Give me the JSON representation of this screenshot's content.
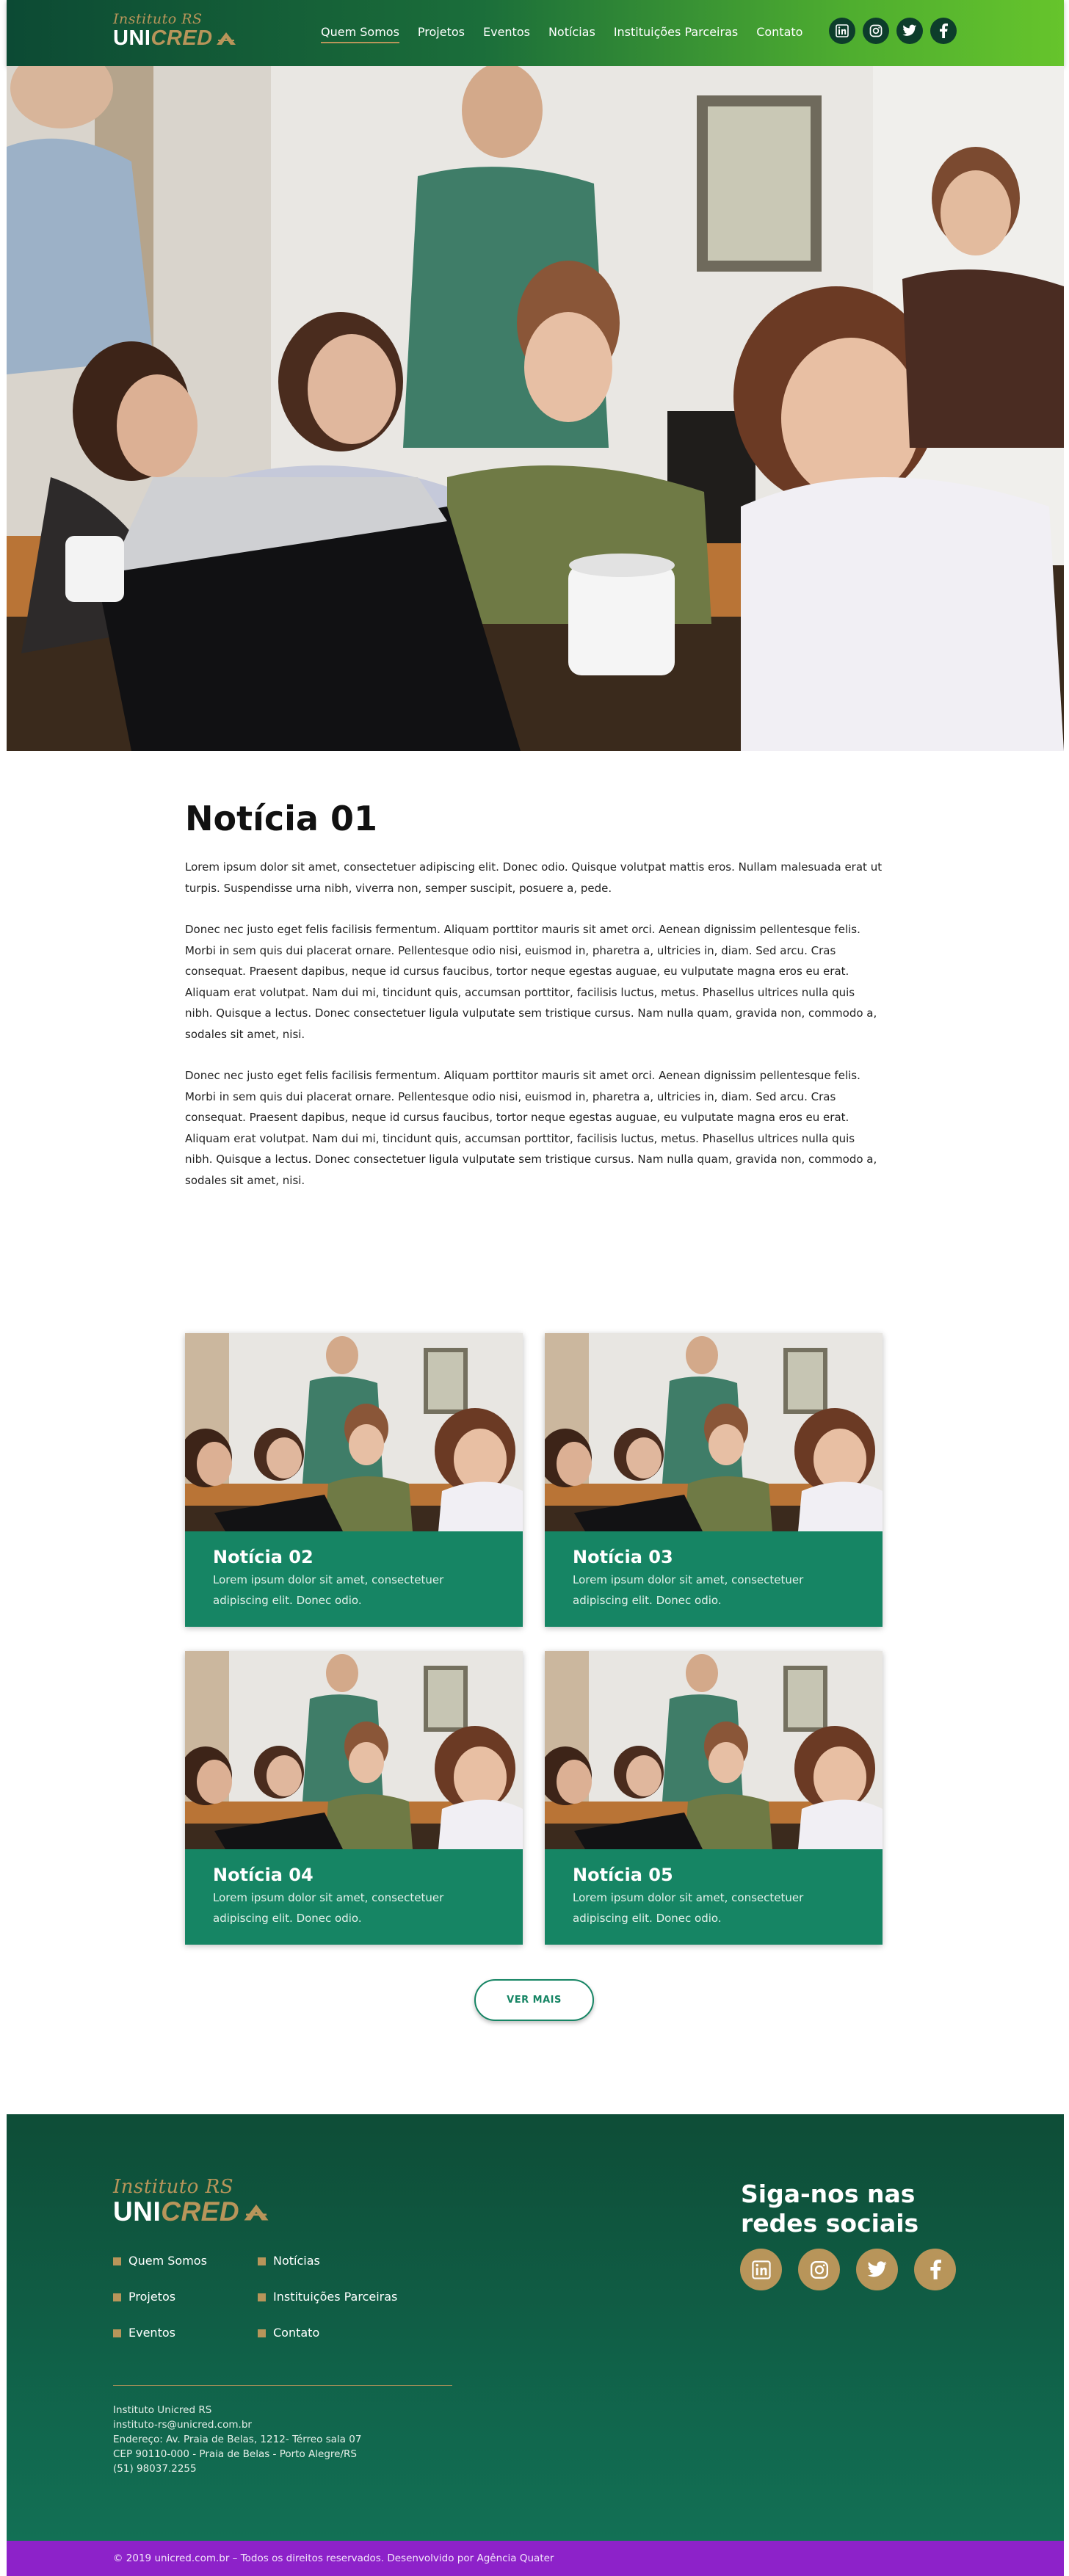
{
  "header": {
    "logo_script": "Instituto RS",
    "logo_uni": "UNI",
    "logo_cred": "CRED",
    "nav": [
      {
        "label": "Quem Somos",
        "active": true
      },
      {
        "label": "Projetos"
      },
      {
        "label": "Eventos"
      },
      {
        "label": "Notícias"
      },
      {
        "label": "Instituições Parceiras"
      },
      {
        "label": "Contato"
      }
    ],
    "social_icons": [
      "linkedin-icon",
      "instagram-icon",
      "twitter-icon",
      "facebook-icon"
    ]
  },
  "article": {
    "title": "Notícia 01",
    "paragraphs": [
      "Lorem ipsum dolor sit amet, consectetuer adipiscing elit. Donec odio. Quisque volutpat mattis eros. Nullam malesuada erat ut turpis. Suspendisse urna nibh, viverra non, semper suscipit, posuere a, pede.",
      "Donec nec justo eget felis facilisis fermentum. Aliquam porttitor mauris sit amet orci. Aenean dignissim pellentesque felis. Morbi in sem quis dui placerat ornare. Pellentesque odio nisi, euismod in, pharetra a, ultricies in, diam. Sed arcu. Cras consequat. Praesent dapibus, neque id cursus faucibus, tortor neque egestas auguae, eu vulputate magna eros eu erat. Aliquam erat volutpat. Nam dui mi, tincidunt quis, accumsan porttitor, facilisis luctus, metus.  Phasellus ultrices nulla quis nibh. Quisque a lectus. Donec consectetuer ligula vulputate sem tristique cursus. Nam nulla quam, gravida non, commodo a, sodales sit amet, nisi.",
      "Donec nec justo eget felis facilisis fermentum. Aliquam porttitor mauris sit amet orci. Aenean dignissim pellentesque felis. Morbi in sem quis dui placerat ornare. Pellentesque odio nisi, euismod in, pharetra a, ultricies in, diam. Sed arcu. Cras consequat. Praesent dapibus, neque id cursus faucibus, tortor neque egestas auguae, eu vulputate magna eros eu erat. Aliquam erat volutpat. Nam dui mi, tincidunt quis, accumsan porttitor, facilisis luctus, metus.  Phasellus ultrices nulla quis nibh. Quisque a lectus. Donec consectetuer ligula vulputate sem tristique cursus. Nam nulla quam, gravida non, commodo a, sodales sit amet, nisi."
    ]
  },
  "news_cards": [
    {
      "title": "Notícia 02",
      "text": "Lorem ipsum dolor sit amet, consectetuer adipiscing elit. Donec odio."
    },
    {
      "title": "Notícia 03",
      "text": "Lorem ipsum dolor sit amet, consectetuer adipiscing elit. Donec odio."
    },
    {
      "title": "Notícia 04",
      "text": "Lorem ipsum dolor sit amet, consectetuer adipiscing elit. Donec odio."
    },
    {
      "title": "Notícia 05",
      "text": "Lorem ipsum dolor sit amet, consectetuer adipiscing elit. Donec odio."
    }
  ],
  "more_button": "VER MAIS",
  "footer": {
    "logo_script": "Instituto RS",
    "logo_uni": "UNI",
    "logo_cred": "CRED",
    "nav": [
      "Quem Somos",
      "Notícias",
      "Projetos",
      "Instituições Parceiras",
      "Eventos",
      "Contato"
    ],
    "contact": [
      "Instituto Unicred RS",
      "instituto-rs@unicred.com.br",
      "Endereço: Av. Praia de Belas, 1212- Térreo sala 07",
      "CEP 90110-000 - Praia de Belas - Porto Alegre/RS",
      "(51) 98037.2255"
    ],
    "social_title": "Siga-nos nas redes sociais",
    "social_icons": [
      "linkedin-icon",
      "instagram-icon",
      "twitter-icon",
      "facebook-icon"
    ]
  },
  "copyright": "© 2019 unicred.com.br – Todos os direitos reservados. Desenvolvido por Agência Quater",
  "colors": {
    "brand_green": "#168564",
    "dark_green": "#0e4d37",
    "gold": "#b8955a",
    "purple": "#8d22c9"
  }
}
